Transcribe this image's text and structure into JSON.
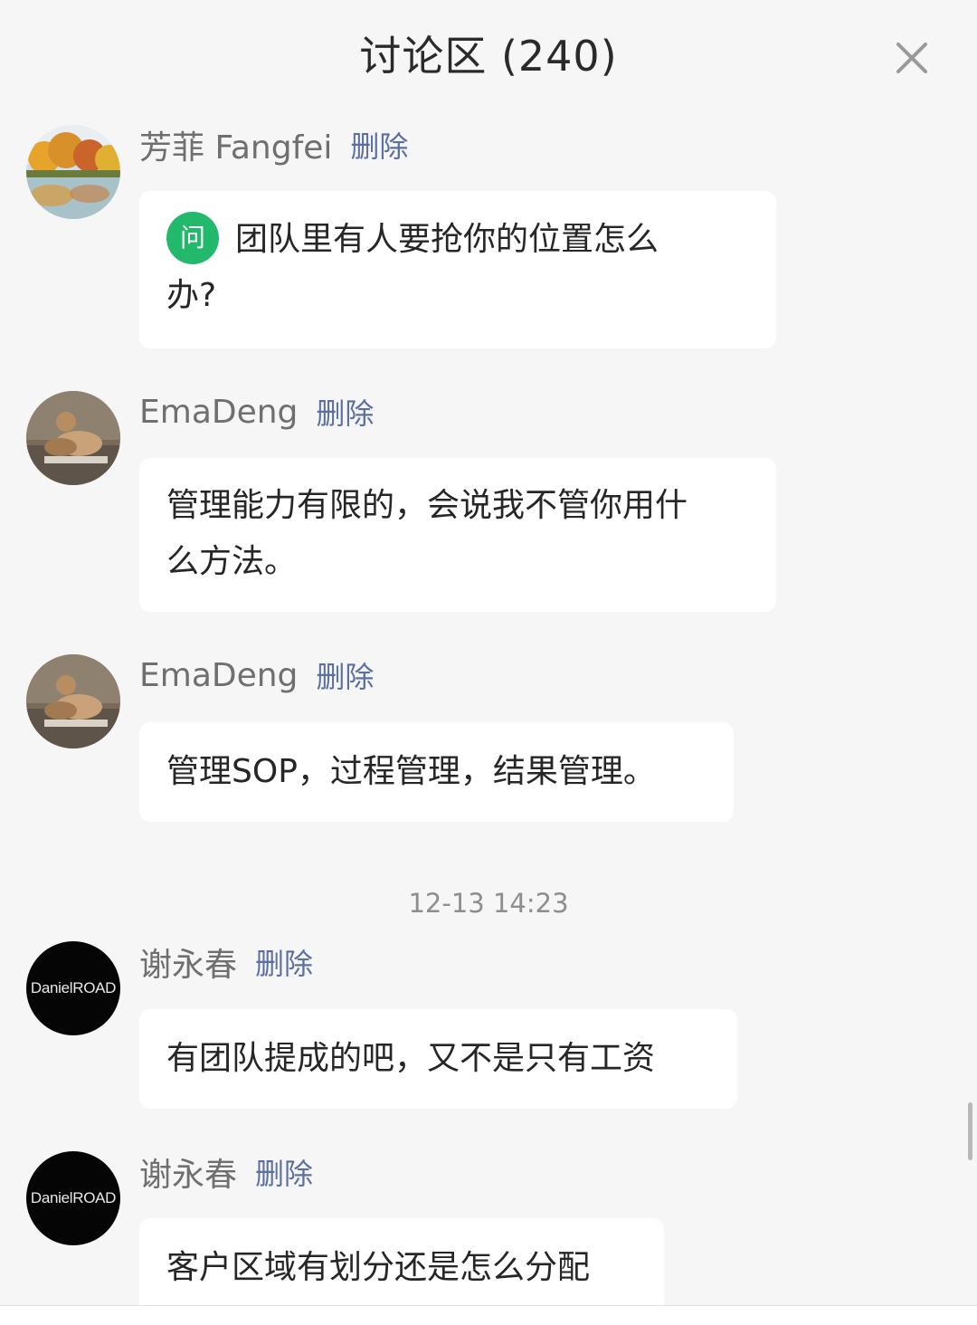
{
  "header": {
    "title": "讨论区 (240)",
    "close_icon": "close-icon"
  },
  "colors": {
    "background": "#f6f6f6",
    "bubble": "#ffffff",
    "name": "#6f6f6f",
    "delete_link": "#5b6fa3",
    "question_badge": "#22b96c"
  },
  "messages": [
    {
      "author": "芳菲 Fangfei",
      "delete_label": "删除",
      "avatar": "landscape-avatar",
      "question_badge": "问",
      "lines": [
        "团队里有人要抢你的位置怎么",
        "办?"
      ]
    },
    {
      "author": "EmaDeng",
      "delete_label": "删除",
      "avatar": "dog-photo-avatar",
      "lines": [
        "管理能力有限的，会说我不管你用什",
        "么方法。"
      ]
    },
    {
      "author": "EmaDeng",
      "delete_label": "删除",
      "avatar": "dog-photo-avatar",
      "lines": [
        "管理SOP，过程管理，结果管理。"
      ]
    },
    {
      "author": "谢永春",
      "delete_label": "删除",
      "avatar": "danielroad-logo-avatar",
      "avatar_text": "DanielROAD",
      "lines": [
        "有团队提成的吧，又不是只有工资"
      ]
    },
    {
      "author": "谢永春",
      "delete_label": "删除",
      "avatar": "danielroad-logo-avatar",
      "avatar_text": "DanielROAD",
      "lines": [
        "客户区域有划分还是怎么分配"
      ]
    }
  ],
  "timestamp": "12-13 14:23"
}
